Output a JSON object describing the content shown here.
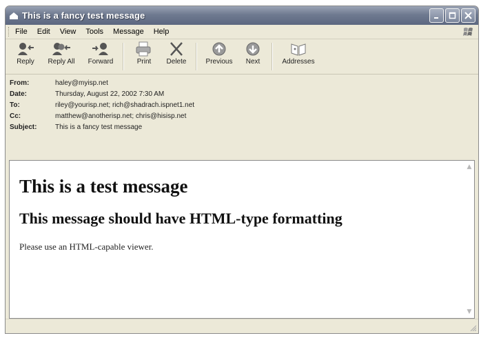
{
  "window": {
    "title": "This is a fancy test message"
  },
  "menu": [
    "File",
    "Edit",
    "View",
    "Tools",
    "Message",
    "Help"
  ],
  "toolbar": [
    {
      "label": "Reply",
      "icon": "reply-icon"
    },
    {
      "label": "Reply All",
      "icon": "reply-all-icon"
    },
    {
      "label": "Forward",
      "icon": "forward-icon"
    },
    {
      "label": "Print",
      "icon": "print-icon"
    },
    {
      "label": "Delete",
      "icon": "delete-icon"
    },
    {
      "label": "Previous",
      "icon": "previous-icon"
    },
    {
      "label": "Next",
      "icon": "next-icon"
    },
    {
      "label": "Addresses",
      "icon": "addresses-icon"
    }
  ],
  "headers": {
    "from_label": "From:",
    "from": "haley@myisp.net",
    "date_label": "Date:",
    "date": "Thursday, August 22, 2002 7:30 AM",
    "to_label": "To:",
    "to": "riley@yourisp.net; rich@shadrach.ispnet1.net",
    "cc_label": "Cc:",
    "cc": "matthew@anotherisp.net; chris@hisisp.net",
    "subject_label": "Subject:",
    "subject": "This is a fancy test message"
  },
  "message": {
    "heading1": "This is a test message",
    "heading2": "This message should have HTML-type formatting",
    "paragraph": "Please use an HTML-capable viewer."
  }
}
